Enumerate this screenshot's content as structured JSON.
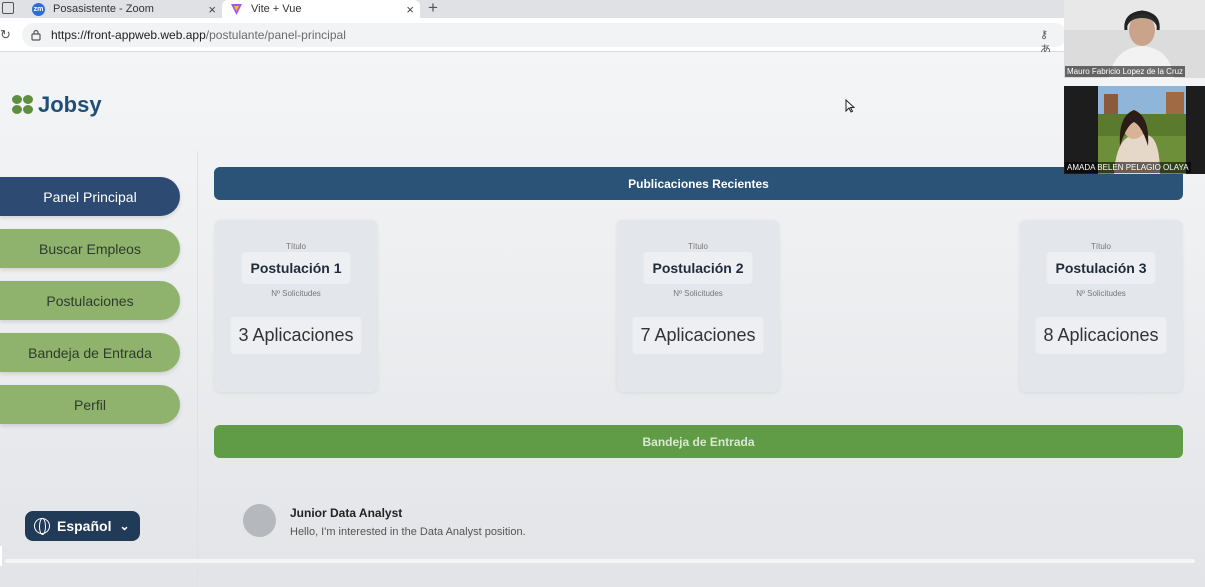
{
  "browser": {
    "tabs": [
      {
        "label": "Posasistente - Zoom",
        "favicon_text": "zm"
      },
      {
        "label": "Vite + Vue"
      }
    ],
    "url_host": "https://front-appweb.web.app",
    "url_path": "/postulante/panel-principal"
  },
  "app": {
    "logo_text": "Jobsy",
    "colors": {
      "primary": "#2c4a72",
      "green": "#8fb36d",
      "banner_green": "#5f9c45"
    }
  },
  "sidebar": {
    "items": [
      {
        "label": "Panel Principal"
      },
      {
        "label": "Buscar Empleos"
      },
      {
        "label": "Postulaciones"
      },
      {
        "label": "Bandeja de Entrada"
      },
      {
        "label": "Perfil"
      }
    ],
    "language": "Español"
  },
  "recent": {
    "header": "Publicaciones Recientes",
    "cards": [
      {
        "title_label": "Título",
        "title": "Postulación 1",
        "count_label": "Nº Solicitudes",
        "count": "3 Aplicaciones"
      },
      {
        "title_label": "Título",
        "title": "Postulación 2",
        "count_label": "Nº Solicitudes",
        "count": "7 Aplicaciones"
      },
      {
        "title_label": "Título",
        "title": "Postulación 3",
        "count_label": "Nº Solicitudes",
        "count": "8 Aplicaciones"
      }
    ]
  },
  "inbox": {
    "header": "Bandeja de Entrada",
    "messages": [
      {
        "sender": "Junior Data Analyst",
        "text": "Hello, I'm interested in the Data Analyst position."
      }
    ]
  },
  "participants": [
    {
      "name": "Mauro Fabricio Lopez de la Cruz"
    },
    {
      "name": "AMADA BELEN PELAGIO OLAYA"
    }
  ]
}
